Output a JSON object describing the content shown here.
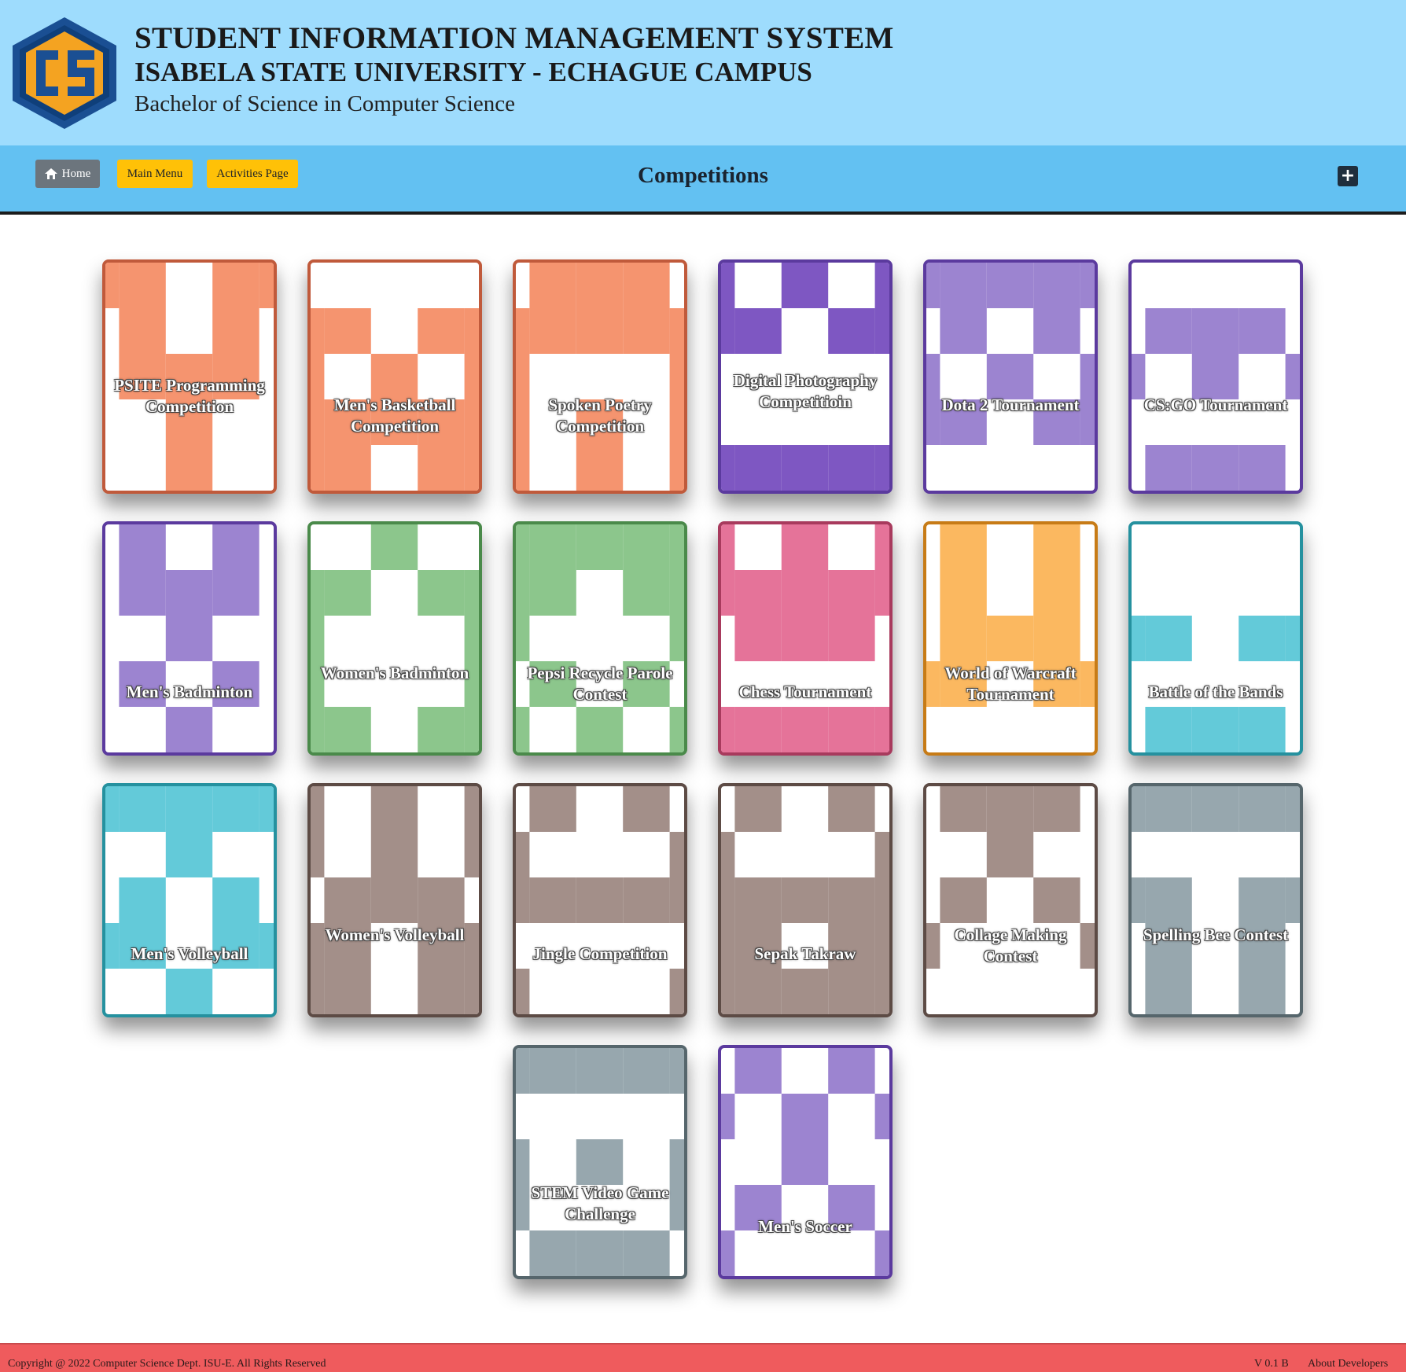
{
  "header": {
    "title": "STUDENT INFORMATION MANAGEMENT SYSTEM",
    "university": "ISABELA STATE UNIVERSITY - ECHAGUE CAMPUS",
    "program": "Bachelor of Science in Computer Science",
    "logo_text": "CS"
  },
  "nav": {
    "home_label": "Home",
    "main_menu_label": "Main Menu",
    "activities_label": "Activities Page",
    "page_title": "Competitions",
    "add_icon": "plus-square-icon"
  },
  "competitions": [
    {
      "name": "PSITE Programming Competition",
      "color": "#f5946f",
      "border": "#c05a3b"
    },
    {
      "name": "Men's Basketball Competition",
      "color": "#f5946f",
      "border": "#c05a3b"
    },
    {
      "name": "Spoken Poetry Competition",
      "color": "#f5946f",
      "border": "#c05a3b"
    },
    {
      "name": "Digital Photography Competitioin",
      "color": "#7e57c2",
      "border": "#5b3a9e"
    },
    {
      "name": "Dota 2 Tournament",
      "color": "#9c84d0",
      "border": "#5b3a9e"
    },
    {
      "name": "CS:GO Tournament",
      "color": "#9c84d0",
      "border": "#5b3a9e"
    },
    {
      "name": "Men's Badminton",
      "color": "#9c84d0",
      "border": "#5b3a9e"
    },
    {
      "name": "Women's Badminton",
      "color": "#8cc68c",
      "border": "#4a8a4a"
    },
    {
      "name": "Pepsi Recycle Parole Contest",
      "color": "#8cc68c",
      "border": "#4a8a4a"
    },
    {
      "name": "Chess Tournament",
      "color": "#e57399",
      "border": "#a83a5d"
    },
    {
      "name": "World of Warcraft Tournament",
      "color": "#fbb860",
      "border": "#c77b16"
    },
    {
      "name": "Battle of the Bands",
      "color": "#63cad9",
      "border": "#25919f"
    },
    {
      "name": "Men's Volleyball",
      "color": "#63cad9",
      "border": "#25919f"
    },
    {
      "name": "Women's Volleyball",
      "color": "#a38f89",
      "border": "#5d4b45"
    },
    {
      "name": "Jingle Competition",
      "color": "#a38f89",
      "border": "#5d4b45"
    },
    {
      "name": "Sepak Takraw",
      "color": "#a38f89",
      "border": "#5d4b45"
    },
    {
      "name": "Collage Making Contest",
      "color": "#a38f89",
      "border": "#5d4b45"
    },
    {
      "name": "Spelling Bee Contest",
      "color": "#97a7ae",
      "border": "#56666c"
    },
    {
      "name": "STEM Video Game Challenge",
      "color": "#97a7ae",
      "border": "#56666c"
    },
    {
      "name": "Men's Soccer",
      "color": "#9c84d0",
      "border": "#5b3a9e"
    }
  ],
  "footer": {
    "copyright": "Copyright @ 2022 Computer Science Dept. ISU-E. All Rights Reserved",
    "version": "V 0.1 B",
    "about": "About Developers"
  },
  "colors": {
    "header_bg": "#9edcfd",
    "navbar_bg": "#63c1f2",
    "footer_bg": "#ef5b5d",
    "btn_secondary": "#6c757d",
    "btn_warning": "#ffc107"
  }
}
